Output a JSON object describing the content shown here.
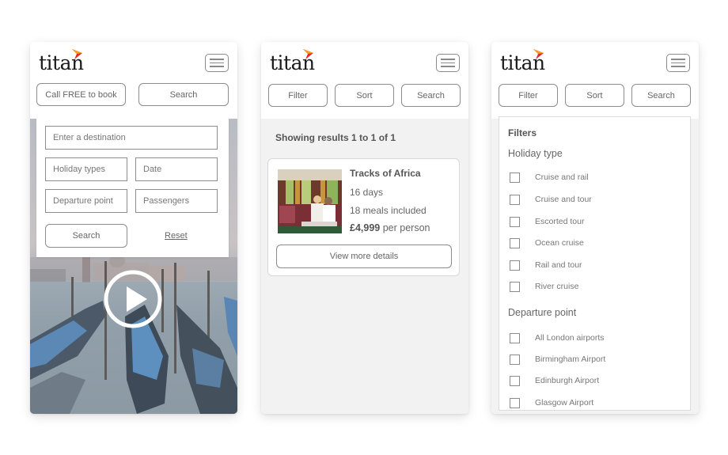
{
  "brand": {
    "logo_text": "titan",
    "flag_colors": [
      "#e8272a",
      "#f7a11a"
    ]
  },
  "screens": {
    "search": {
      "call_button": "Call FREE to book",
      "search_button": "Search",
      "form": {
        "destination_placeholder": "Enter a destination",
        "holiday_types_placeholder": "Holiday types",
        "date_placeholder": "Date",
        "departure_point_placeholder": "Departure point",
        "passengers_placeholder": "Passengers",
        "search_button": "Search",
        "reset_link": "Reset"
      },
      "hero": {
        "image_alt": "Gondolas in Venice",
        "play_icon": "play-circle-icon"
      }
    },
    "results": {
      "filter_button": "Filter",
      "sort_button": "Sort",
      "search_button": "Search",
      "summary": "Showing results 1 to 1 of 1",
      "items": [
        {
          "title": "Tracks of Africa",
          "duration": "16 days",
          "meals": "18 meals included",
          "price": "£4,999",
          "price_suffix": "per person",
          "details_button": "View more details",
          "image_alt": "Couple in luxury train carriage"
        }
      ]
    },
    "filters": {
      "filter_button": "Filter",
      "sort_button": "Sort",
      "search_button": "Search",
      "title": "Filters",
      "sections": [
        {
          "title": "Holiday type",
          "options": [
            {
              "label": "Cruise and rail",
              "checked": false
            },
            {
              "label": "Cruise and tour",
              "checked": false
            },
            {
              "label": "Escorted tour",
              "checked": false
            },
            {
              "label": "Ocean cruise",
              "checked": false
            },
            {
              "label": "Rail and tour",
              "checked": false
            },
            {
              "label": "River cruise",
              "checked": false
            }
          ]
        },
        {
          "title": "Departure point",
          "options": [
            {
              "label": "All London airports",
              "checked": false
            },
            {
              "label": "Birmingham Airport",
              "checked": false
            },
            {
              "label": "Edinburgh Airport",
              "checked": false
            },
            {
              "label": "Glasgow Airport",
              "checked": false
            }
          ]
        }
      ]
    }
  }
}
